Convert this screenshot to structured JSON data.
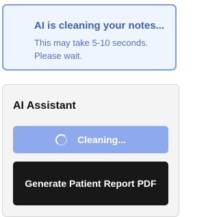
{
  "notice": {
    "title": "AI is cleaning your notes...",
    "message": "This may take 5-10 seconds. Please wait."
  },
  "assistant": {
    "title": "AI Assistant",
    "cleaning_button_label": "Cleaning...",
    "cleaning_icon": "spinner-icon",
    "report_button_label": "Generate Patient Report PDF"
  },
  "colors": {
    "notice_border": "#7ba0e6",
    "notice_background": "#eff5ff",
    "notice_title": "#4262ad",
    "notice_text": "#4f74cf",
    "cleaning_button": "#8eaaec",
    "report_button": "#181818"
  }
}
